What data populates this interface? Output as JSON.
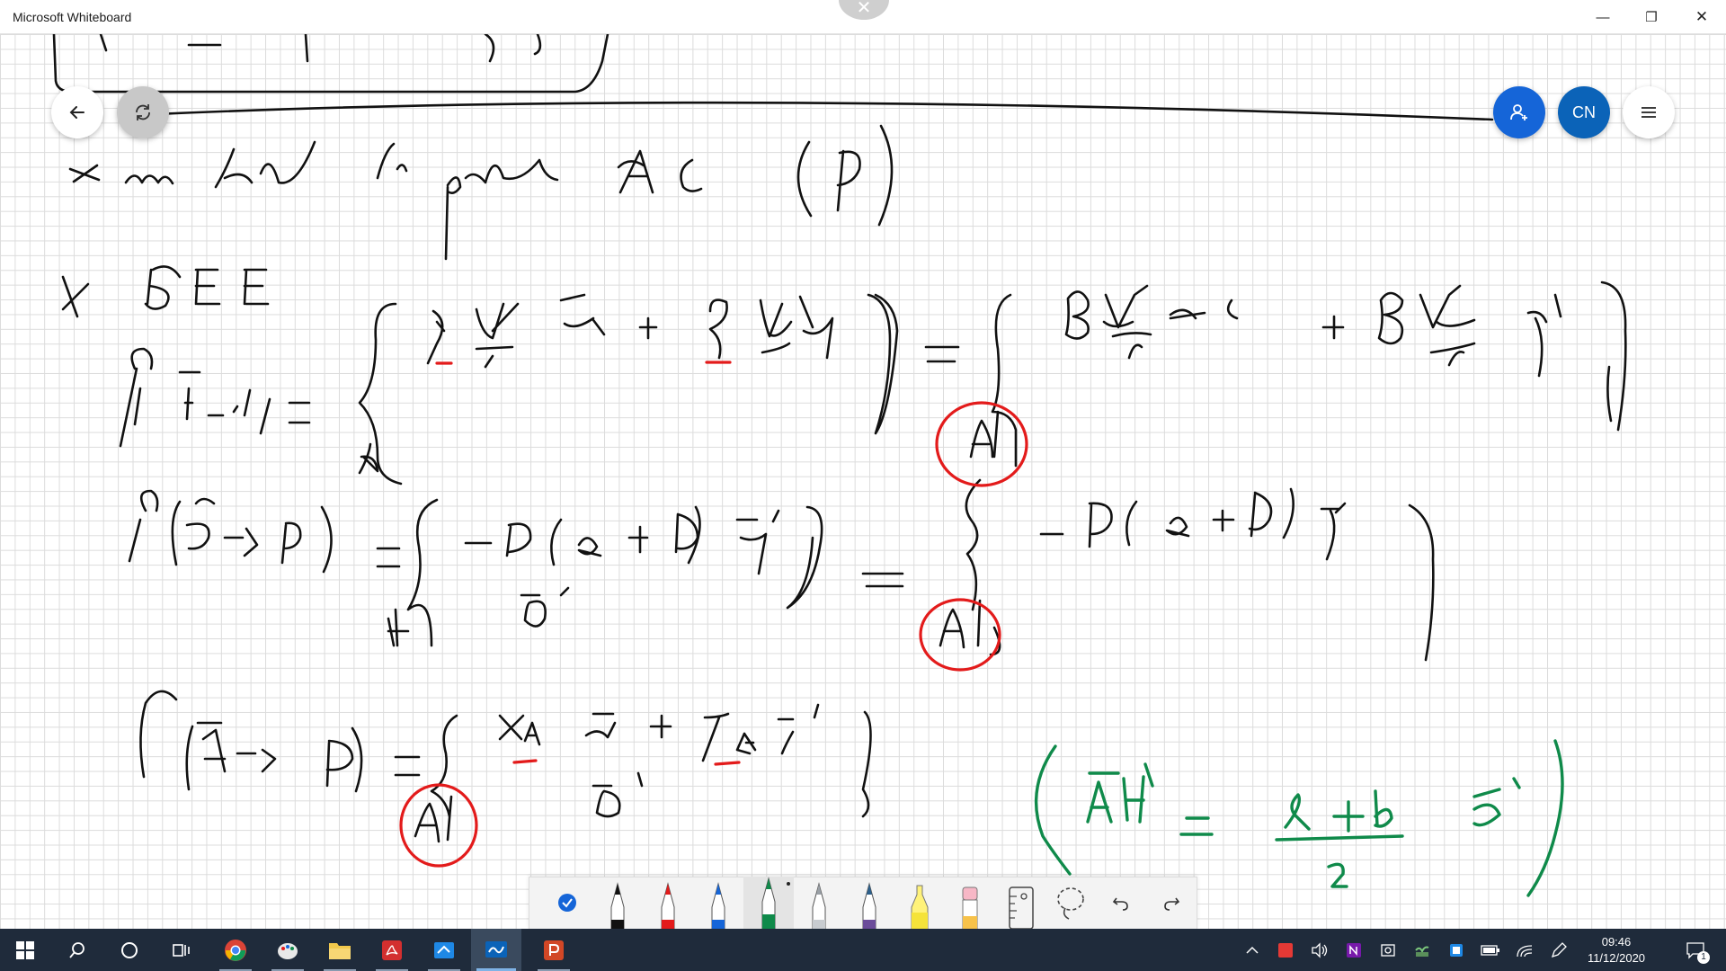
{
  "window": {
    "title": "Microsoft Whiteboard",
    "controls": {
      "minimize": "—",
      "restore": "❐",
      "close": "✕"
    }
  },
  "whiteboard": {
    "user_initials": "CN",
    "ink_colors": {
      "black": "#111111",
      "red": "#e31b1b",
      "green": "#0f8a4a"
    }
  },
  "toolbar": {
    "tools": [
      "select",
      "black-pen",
      "red-pen",
      "blue-pen",
      "green-pen",
      "silver-pen",
      "galaxy-pen",
      "highlighter",
      "eraser",
      "ruler",
      "lasso",
      "undo",
      "redo"
    ],
    "selected_tool": "green-pen"
  },
  "taskbar": {
    "apps": [
      "start",
      "search",
      "cortana",
      "task-view",
      "chrome",
      "paint",
      "file-explorer",
      "acrobat",
      "whiteboard-app",
      "whiteboard-active",
      "powerpoint"
    ],
    "time": "09:46",
    "date": "11/12/2020",
    "notification_count": "1"
  }
}
